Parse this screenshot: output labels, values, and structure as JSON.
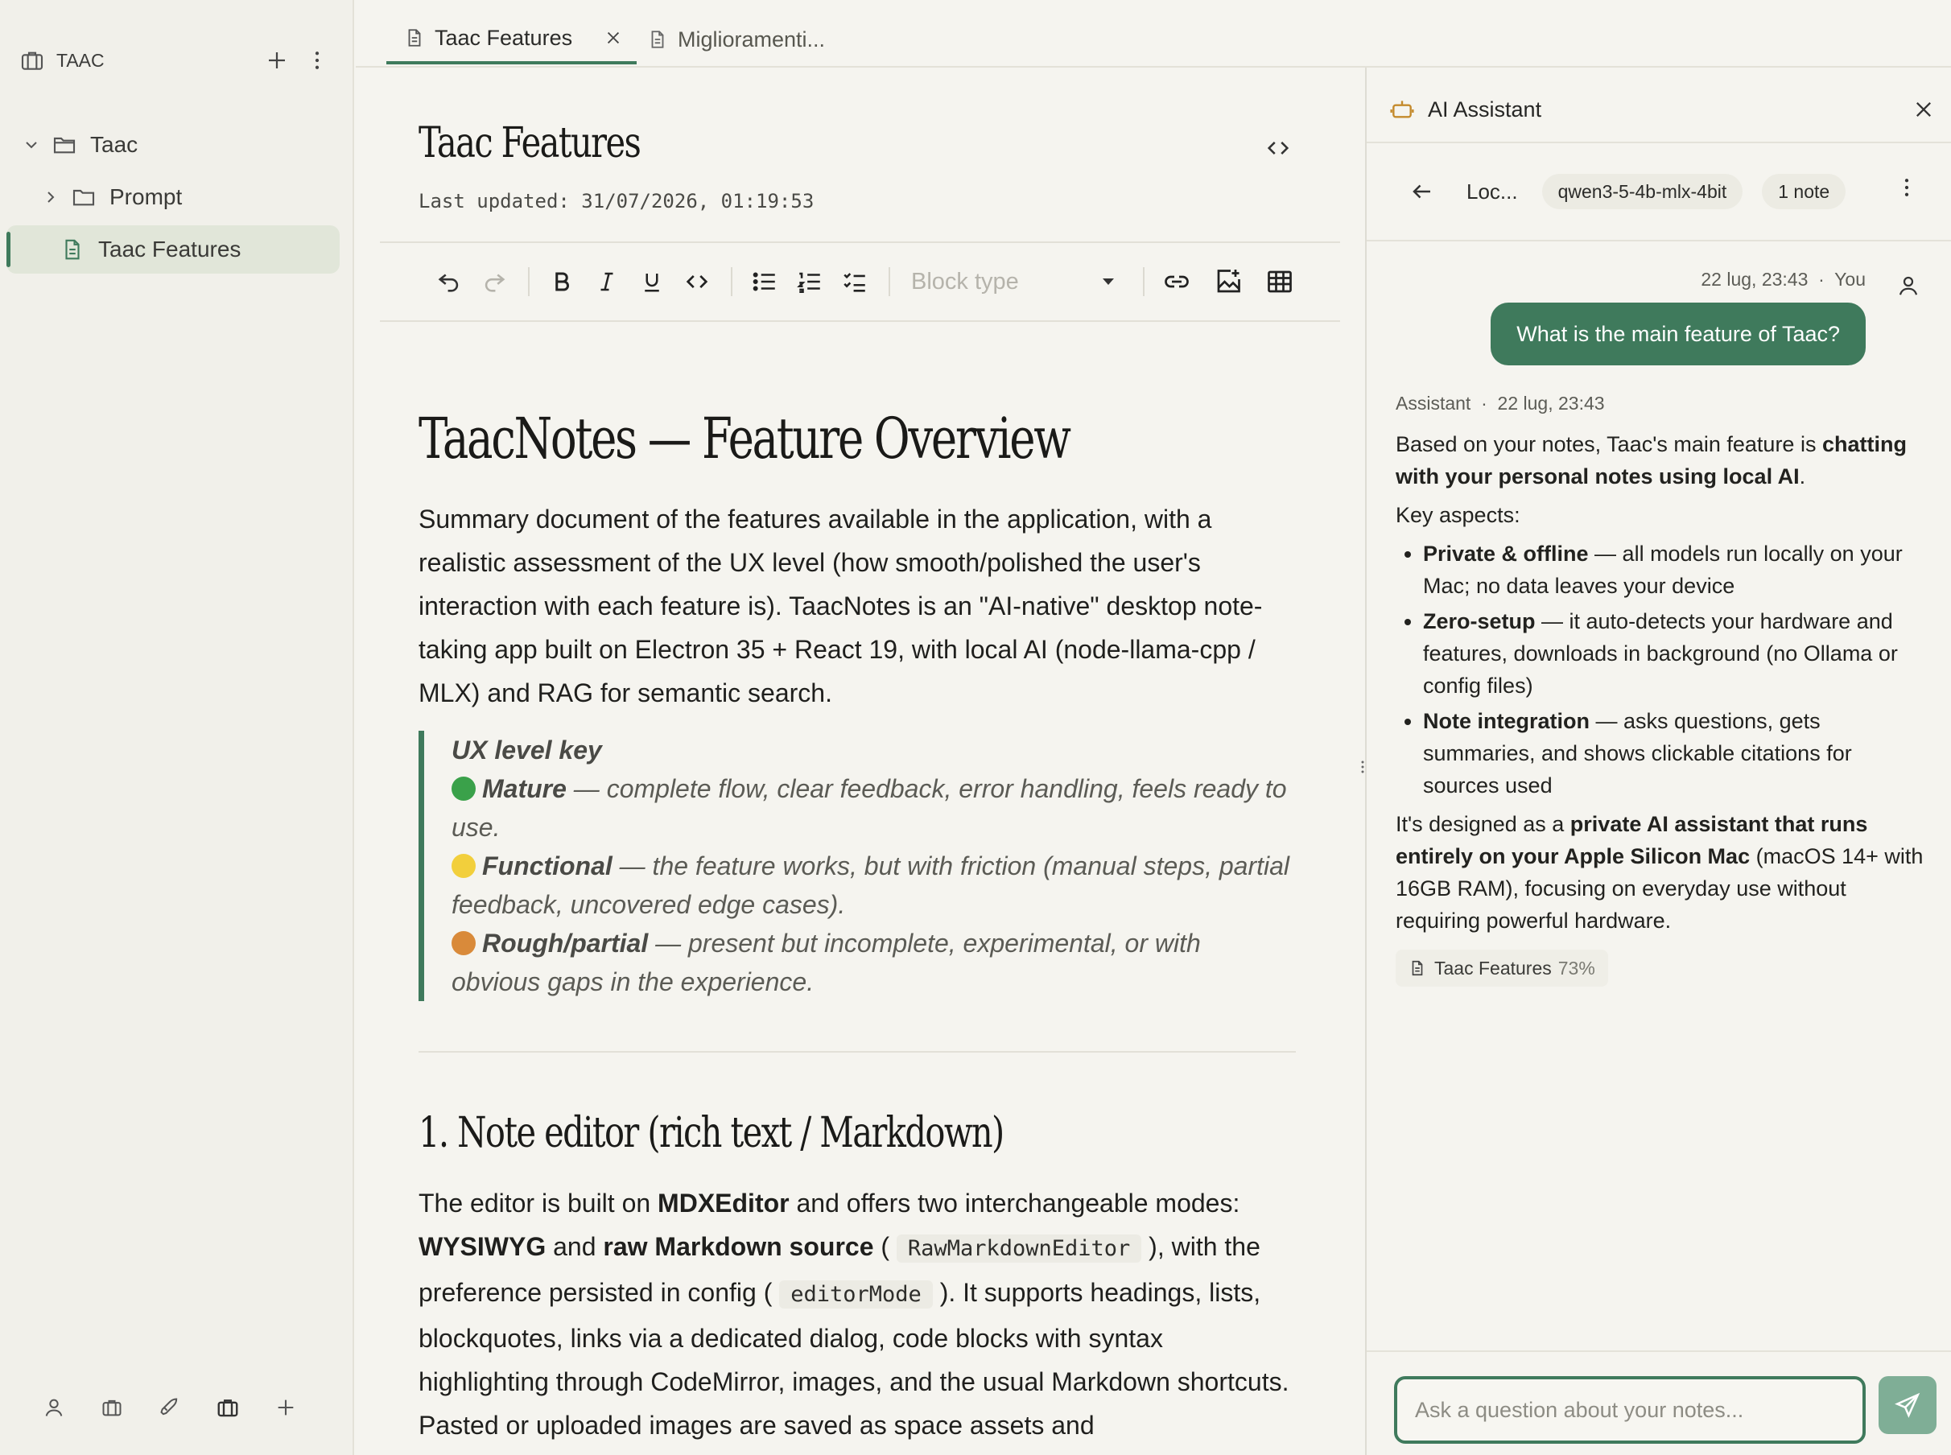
{
  "sidebar": {
    "space_name": "TAAC",
    "tree": [
      {
        "label": "Taac",
        "type": "folder",
        "expanded": true
      },
      {
        "label": "Prompt",
        "type": "folder",
        "expanded": false
      },
      {
        "label": "Taac Features",
        "type": "note",
        "active": true
      }
    ],
    "footer_icons": [
      "person-icon",
      "briefcase-icon",
      "rocket-icon",
      "briefcase-icon",
      "plus-icon"
    ]
  },
  "tabs": [
    {
      "label": "Taac Features",
      "active": true
    },
    {
      "label": "Miglioramenti...",
      "active": false
    }
  ],
  "editor": {
    "title": "Taac Features",
    "last_updated": "Last updated: 31/07/2026, 01:19:53",
    "toolbar": {
      "block_type_placeholder": "Block type"
    },
    "h1": "TaacNotes — Feature Overview",
    "intro": "Summary document of the features available in the application, with a realistic assessment of the UX level (how smooth/polished the user's interaction with each feature is). TaacNotes is an \"AI-native\" desktop note-taking app built on Electron 35 + React 19, with local AI (node-llama-cpp / MLX) and RAG for semantic search.",
    "ux_key": {
      "title": "UX level key",
      "levels": [
        {
          "name": "Mature",
          "desc": " — complete flow, clear feedback, error handling, feels ready to use.",
          "color": "#3aa14a"
        },
        {
          "name": "Functional",
          "desc": " — the feature works, but with friction (manual steps, partial feedback, uncovered edge cases).",
          "color": "#f2cf3c"
        },
        {
          "name": "Rough/partial",
          "desc": " — present but incomplete, experimental, or with obvious gaps in the experience.",
          "color": "#d98a3a"
        }
      ]
    },
    "h2": "1. Note editor (rich text / Markdown)",
    "section1": {
      "t1": "The editor is built on ",
      "b1": "MDXEditor",
      "t2": " and offers two interchangeable modes: ",
      "b2": "WYSIWYG",
      "t3": " and ",
      "b3": "raw Markdown source",
      "t4": " ( ",
      "c1": "RawMarkdownEditor",
      "t5": " ), with the preference persisted in config ( ",
      "c2": "editorMode",
      "t6": " ). It supports headings, lists, blockquotes, links via a dedicated dialog, code blocks with syntax highlighting through CodeMirror, images, and the usual Markdown shortcuts. Pasted or uploaded images are saved as space assets and"
    }
  },
  "assistant": {
    "title": "AI Assistant",
    "conversation_label": "Loc...",
    "model": "qwen3-5-4b-mlx-4bit",
    "notes_count": "1 note",
    "user_meta": "22 lug, 23:43  ·  You",
    "user_message": "What is the main feature of Taac?",
    "assistant_meta": "Assistant  ·  22 lug, 23:43",
    "reply": {
      "p1a": "Based on your notes, Taac's main feature is ",
      "p1b": "chatting with your personal notes using local AI",
      "p1c": ".",
      "key_aspects": "Key aspects:",
      "bullets": [
        {
          "b": "Private & offline",
          "t": " — all models run locally on your Mac; no data leaves your device"
        },
        {
          "b": "Zero-setup",
          "t": " — it auto-detects your hardware and features, downloads in background (no Ollama or config files)"
        },
        {
          "b": "Note integration",
          "t": " — asks questions, gets summaries, and shows clickable citations for sources used"
        }
      ],
      "p2a": "It's designed as a ",
      "p2b": "private AI assistant that runs entirely on your Apple Silicon Mac",
      "p2c": " (macOS 14+ with 16GB RAM), focusing on everyday use without requiring powerful hardware."
    },
    "citation": {
      "note": "Taac Features",
      "score": "73%"
    },
    "input_placeholder": "Ask a question about your notes..."
  },
  "colors": {
    "accent": "#3f7a5c",
    "send_button": "#7fae96",
    "active_row": "#e1e6d9"
  }
}
